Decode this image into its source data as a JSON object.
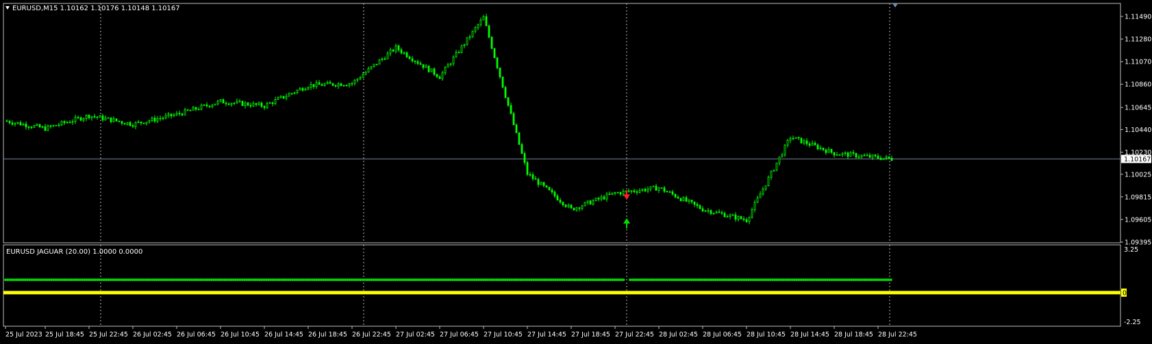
{
  "colors": {
    "background": "#000000",
    "frame": "#c0c0c0",
    "grid": "#c0c0c0",
    "bull_candle": "#00ff00",
    "bear_candle": "#00ff00",
    "bid_line": "#778899",
    "sell_arrow": "#ff2020",
    "buy_arrow": "#00e000",
    "signal_dots": "#00e000",
    "zero_line": "#ffff00",
    "axis_text": "#ffffff",
    "price_label_bg": "#ffffff",
    "price_label_text": "#000000",
    "zero_label_bg": "#ffff00"
  },
  "main_window": {
    "header": "EURUSD,M15  1.10162 1.10176 1.10148 1.10167",
    "header_icon": "triangle-down-icon",
    "price_ticks": [
      "1.11490",
      "1.11280",
      "1.11070",
      "1.10860",
      "1.10645",
      "1.10440",
      "1.10230",
      "1.10025",
      "1.09815",
      "1.09605",
      "1.09395"
    ],
    "current_price": "1.10167",
    "chart_type": "candlestick",
    "timeframe": "M15",
    "symbol": "EURUSD"
  },
  "sub_window": {
    "header": "EURUSD  JAGUAR (20.00) 1.0000 0.0000",
    "scale_top": "3.25",
    "scale_zero": "0.00",
    "scale_bottom": "-2.25"
  },
  "time_axis": {
    "labels": [
      "25 Jul 2023",
      "25 Jul 18:45",
      "25 Jul 22:45",
      "26 Jul 02:45",
      "26 Jul 06:45",
      "26 Jul 10:45",
      "26 Jul 14:45",
      "26 Jul 18:45",
      "26 Jul 22:45",
      "27 Jul 02:45",
      "27 Jul 06:45",
      "27 Jul 10:45",
      "27 Jul 14:45",
      "27 Jul 18:45",
      "27 Jul 22:45",
      "28 Jul 02:45",
      "28 Jul 06:45",
      "28 Jul 10:45",
      "28 Jul 14:45",
      "28 Jul 18:45",
      "28 Jul 22:45"
    ]
  },
  "chart_data": {
    "type": "line",
    "title": "EURUSD,M15",
    "ylim": [
      1.09395,
      1.1158
    ],
    "x": [
      "25 Jul 2023",
      "25 Jul 18:45",
      "25 Jul 22:45",
      "26 Jul 02:45",
      "26 Jul 06:45",
      "26 Jul 10:45",
      "26 Jul 14:45",
      "26 Jul 18:45",
      "26 Jul 22:45",
      "27 Jul 02:45",
      "27 Jul 06:45",
      "27 Jul 10:45",
      "27 Jul 14:45",
      "27 Jul 18:45",
      "27 Jul 22:45",
      "28 Jul 02:45",
      "28 Jul 06:45",
      "28 Jul 10:45",
      "28 Jul 14:45",
      "28 Jul 18:45",
      "28 Jul 22:45"
    ],
    "series": [
      {
        "name": "EURUSD",
        "values": [
          1.1052,
          1.1045,
          1.1057,
          1.1049,
          1.1058,
          1.107,
          1.1066,
          1.1085,
          1.1087,
          1.112,
          1.1093,
          1.1148,
          1.1003,
          1.097,
          1.0985,
          1.099,
          1.097,
          1.096,
          1.1037,
          1.1022,
          1.10167
        ]
      }
    ],
    "vertical_grid_at": [
      "25 Jul 22:45",
      "26 Jul 22:45",
      "27 Jul 22:45",
      "28 Jul 22:45"
    ],
    "annotations": [
      {
        "type": "sell-arrow",
        "at": "27 Jul 22:45",
        "price": 1.098
      },
      {
        "type": "buy-arrow",
        "at": "27 Jul 22:45",
        "price": 1.0958
      }
    ],
    "indicator": {
      "name": "JAGUAR",
      "ylim": [
        -2.25,
        3.25
      ],
      "signal_level": 1.0,
      "zero_level": 0.0,
      "gap_at": "27 Jul 22:45"
    }
  }
}
